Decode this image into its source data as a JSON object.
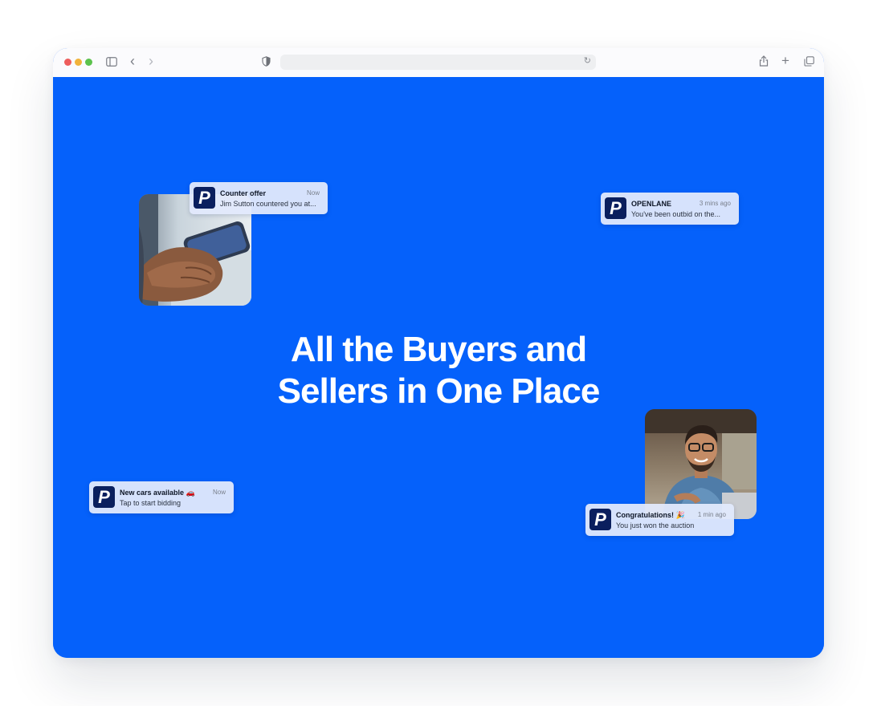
{
  "browser": {
    "nav_back": "‹",
    "nav_forward": "›",
    "reload": "↻",
    "share": "⇪",
    "new_tab": "+",
    "tabs_overview": "⧉"
  },
  "hero": {
    "line1": "All the Buyers and",
    "line2": "Sellers in One Place"
  },
  "notifications": {
    "counter_offer": {
      "logo": "P",
      "title": "Counter offer",
      "text": "Jim Sutton countered you at...",
      "time": "Now"
    },
    "outbid": {
      "logo": "P",
      "title": "OPENLANE",
      "text": "You've been outbid on the...",
      "time": "3 mins ago"
    },
    "new_cars": {
      "logo": "P",
      "title": "New cars available 🚗",
      "text": "Tap to start bidding",
      "time": "Now"
    },
    "won": {
      "logo": "P",
      "title": "Congratulations! 🎉",
      "text": "You just won the auction",
      "time": "1 min ago"
    }
  },
  "colors": {
    "background": "#0561fb",
    "logo": "#0a1f5e",
    "notification": "#e1e9fc"
  }
}
